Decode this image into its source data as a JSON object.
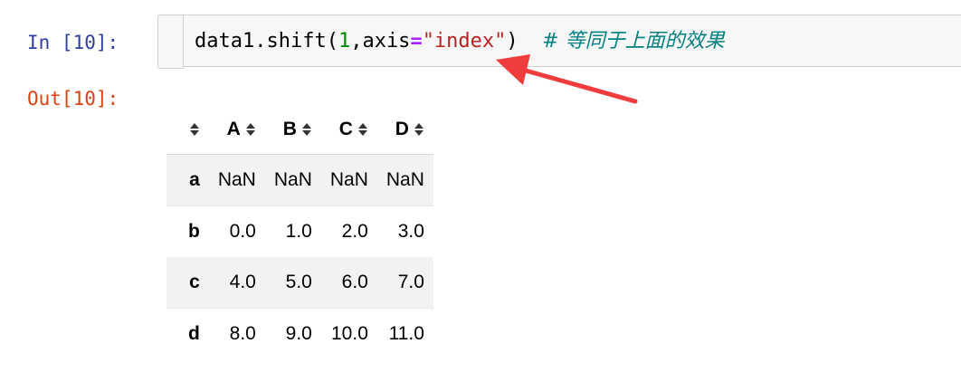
{
  "cell": {
    "in_prompt": "In [10]:",
    "out_prompt": "Out[10]:",
    "code": {
      "t1": "data1.shift(",
      "t2": "1",
      "t3": ",axis",
      "t4": "=",
      "t5": "\"index\"",
      "t6": ")  ",
      "comment": "# 等同于上面的效果"
    }
  },
  "dataframe": {
    "columns": [
      "A",
      "B",
      "C",
      "D"
    ],
    "rows": [
      {
        "index": "a",
        "values": [
          "NaN",
          "NaN",
          "NaN",
          "NaN"
        ]
      },
      {
        "index": "b",
        "values": [
          "0.0",
          "1.0",
          "2.0",
          "3.0"
        ]
      },
      {
        "index": "c",
        "values": [
          "4.0",
          "5.0",
          "6.0",
          "7.0"
        ]
      },
      {
        "index": "d",
        "values": [
          "8.0",
          "9.0",
          "10.0",
          "11.0"
        ]
      }
    ]
  },
  "colors": {
    "in_prompt": "#303F9F",
    "out_prompt": "#D84315",
    "arrow": "#F03C3C"
  },
  "icons": {
    "sort": "sort-icon",
    "annotation": "red-arrow-annotation"
  }
}
